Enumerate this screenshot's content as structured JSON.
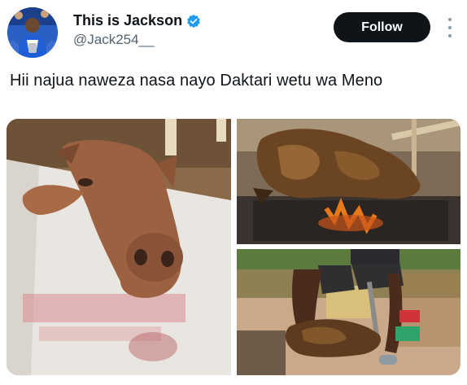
{
  "tweet": {
    "author": {
      "display_name": "This is Jackson",
      "handle": "@Jack254__",
      "verified": true,
      "avatar_icon": "profile-avatar"
    },
    "follow_label": "Follow",
    "more_icon": "vertical-ellipsis-icon",
    "text": "Hii najua naweza nasa nayo Daktari wetu wa Meno",
    "media": [
      {
        "description_icon": "photo-cow-head-on-sack"
      },
      {
        "description_icon": "photo-head-roasting-on-fire"
      },
      {
        "description_icon": "photo-man-with-head-and-machete"
      }
    ]
  },
  "colors": {
    "follow_bg": "#0f1419",
    "follow_text": "#ffffff",
    "verified": "#1d9bf0",
    "handle": "#536471"
  }
}
